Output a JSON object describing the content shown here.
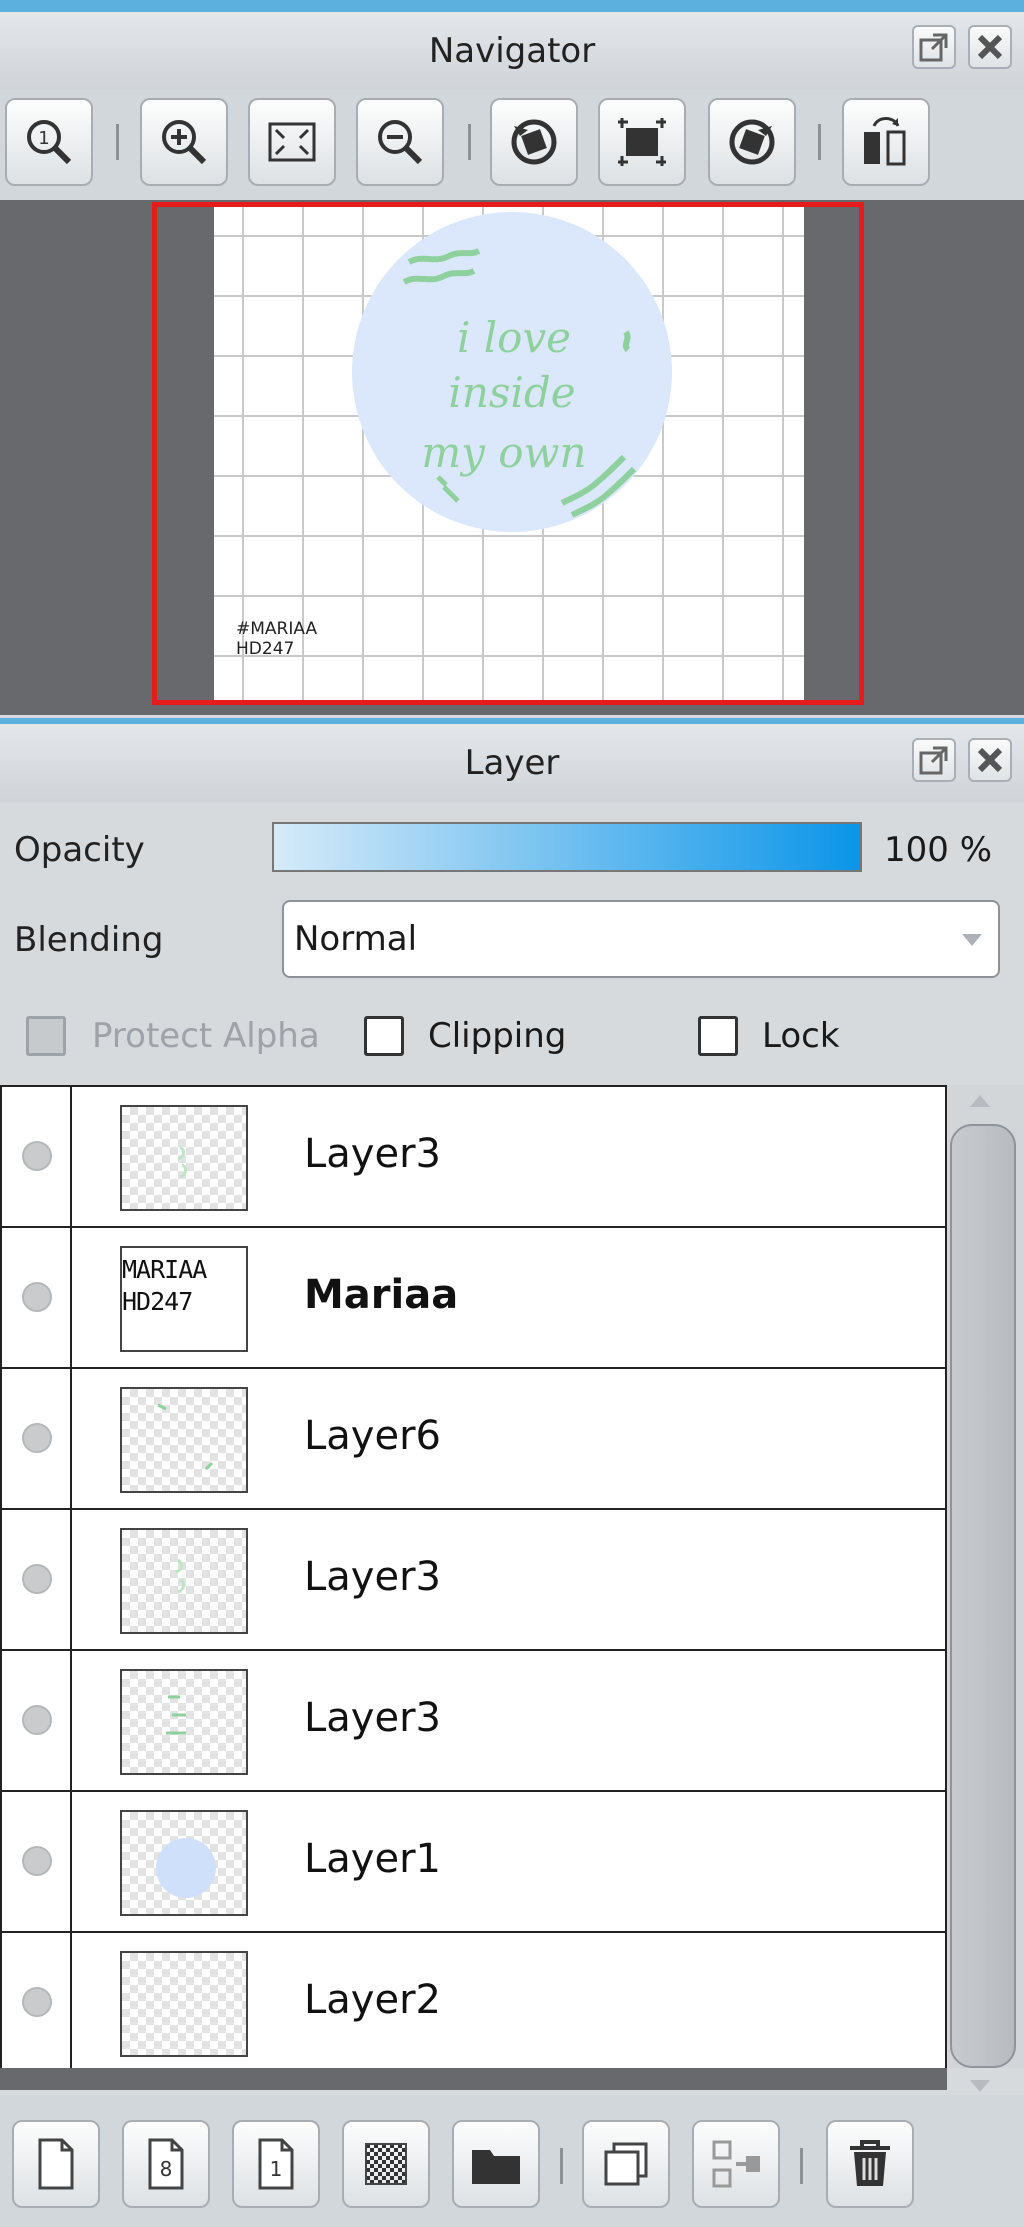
{
  "navigator": {
    "title": "Navigator",
    "toolbar_icons": [
      "zoom-actual-icon",
      "zoom-in-icon",
      "fit-screen-icon",
      "zoom-out-icon",
      "rotate-left-icon",
      "reset-view-icon",
      "rotate-right-icon",
      "flip-horizontal-icon"
    ],
    "preview": {
      "text_lines": [
        "i love",
        "inside",
        "my own"
      ],
      "watermark_lines": [
        "#MARIAA",
        "HD247"
      ]
    }
  },
  "layer_panel": {
    "title": "Layer",
    "opacity_label": "Opacity",
    "opacity_value": "100 %",
    "opacity": 1.0,
    "blending_label": "Blending",
    "blending_value": "Normal",
    "protect_alpha_label": "Protect Alpha",
    "clipping_label": "Clipping",
    "lock_label": "Lock",
    "layers": [
      {
        "name": "Layer3",
        "selected": false
      },
      {
        "name": "Mariaa",
        "selected": true,
        "thumb_text": [
          "MARIAA",
          "HD247"
        ]
      },
      {
        "name": "Layer6",
        "selected": false
      },
      {
        "name": "Layer3",
        "selected": false
      },
      {
        "name": "Layer3",
        "selected": false
      },
      {
        "name": "Layer1",
        "selected": false
      },
      {
        "name": "Layer2",
        "selected": false
      }
    ],
    "bottom_icons": [
      "new-layer-icon",
      "new-8bit-layer-icon",
      "new-1bit-layer-icon",
      "new-halftone-layer-icon",
      "new-folder-icon",
      "duplicate-layer-icon",
      "merge-down-icon",
      "delete-layer-icon"
    ]
  },
  "colors": {
    "accent_blue": "#5bb0dd",
    "selected_row": "#7fcff8",
    "frame_red": "#e61b1b",
    "art_green": "#8fd19e",
    "art_circle": "#dbe8fb"
  }
}
